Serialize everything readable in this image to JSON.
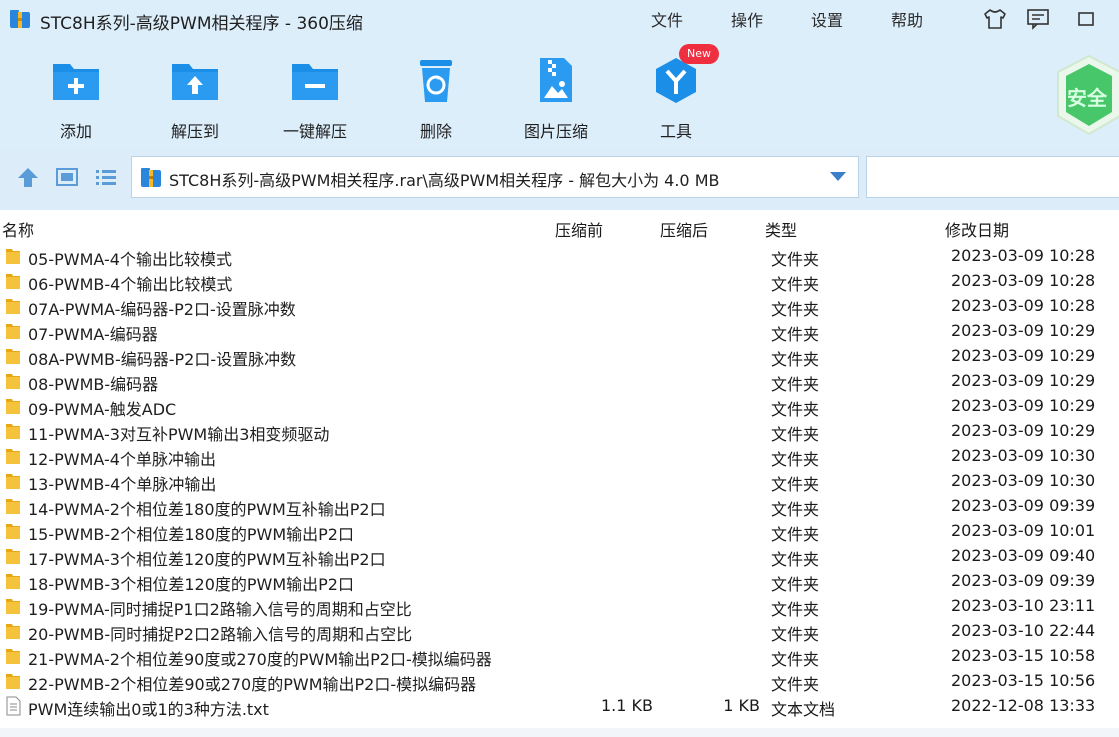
{
  "window": {
    "title": "STC8H系列-高级PWM相关程序 - 360压缩",
    "menu": [
      "文件",
      "操作",
      "设置",
      "帮助"
    ],
    "title_icons": [
      "tshirt-icon",
      "feedback-icon",
      "minimize-icon"
    ]
  },
  "toolbar": {
    "items": [
      {
        "label": "添加",
        "icon": "add-folder-icon"
      },
      {
        "label": "解压到",
        "icon": "extract-to-icon"
      },
      {
        "label": "一键解压",
        "icon": "one-click-extract-icon"
      },
      {
        "label": "删除",
        "icon": "delete-icon"
      },
      {
        "label": "图片压缩",
        "icon": "image-compress-icon"
      },
      {
        "label": "工具",
        "icon": "tools-icon"
      }
    ],
    "new_badge": "New",
    "safe_label": "安全"
  },
  "address": {
    "path": "STC8H系列-高级PWM相关程序.rar\\高级PWM相关程序 - 解包大小为 4.0 MB"
  },
  "columns": {
    "name": "名称",
    "before": "压缩前",
    "after": "压缩后",
    "type": "类型",
    "modified": "修改日期"
  },
  "files": [
    {
      "name": "05-PWMA-4个输出比较模式",
      "before": "",
      "after": "",
      "type": "文件夹",
      "date": "2023-03-09 10:28",
      "kind": "folder"
    },
    {
      "name": "06-PWMB-4个输出比较模式",
      "before": "",
      "after": "",
      "type": "文件夹",
      "date": "2023-03-09 10:28",
      "kind": "folder"
    },
    {
      "name": "07A-PWMA-编码器-P2口-设置脉冲数",
      "before": "",
      "after": "",
      "type": "文件夹",
      "date": "2023-03-09 10:28",
      "kind": "folder"
    },
    {
      "name": "07-PWMA-编码器",
      "before": "",
      "after": "",
      "type": "文件夹",
      "date": "2023-03-09 10:29",
      "kind": "folder"
    },
    {
      "name": "08A-PWMB-编码器-P2口-设置脉冲数",
      "before": "",
      "after": "",
      "type": "文件夹",
      "date": "2023-03-09 10:29",
      "kind": "folder"
    },
    {
      "name": "08-PWMB-编码器",
      "before": "",
      "after": "",
      "type": "文件夹",
      "date": "2023-03-09 10:29",
      "kind": "folder"
    },
    {
      "name": "09-PWMA-触发ADC",
      "before": "",
      "after": "",
      "type": "文件夹",
      "date": "2023-03-09 10:29",
      "kind": "folder"
    },
    {
      "name": "11-PWMA-3对互补PWM输出3相变频驱动",
      "before": "",
      "after": "",
      "type": "文件夹",
      "date": "2023-03-09 10:29",
      "kind": "folder"
    },
    {
      "name": "12-PWMA-4个单脉冲输出",
      "before": "",
      "after": "",
      "type": "文件夹",
      "date": "2023-03-09 10:30",
      "kind": "folder"
    },
    {
      "name": "13-PWMB-4个单脉冲输出",
      "before": "",
      "after": "",
      "type": "文件夹",
      "date": "2023-03-09 10:30",
      "kind": "folder"
    },
    {
      "name": "14-PWMA-2个相位差180度的PWM互补输出P2口",
      "before": "",
      "after": "",
      "type": "文件夹",
      "date": "2023-03-09 09:39",
      "kind": "folder"
    },
    {
      "name": "15-PWMB-2个相位差180度的PWM输出P2口",
      "before": "",
      "after": "",
      "type": "文件夹",
      "date": "2023-03-09 10:01",
      "kind": "folder"
    },
    {
      "name": "17-PWMA-3个相位差120度的PWM互补输出P2口",
      "before": "",
      "after": "",
      "type": "文件夹",
      "date": "2023-03-09 09:40",
      "kind": "folder"
    },
    {
      "name": "18-PWMB-3个相位差120度的PWM输出P2口",
      "before": "",
      "after": "",
      "type": "文件夹",
      "date": "2023-03-09 09:39",
      "kind": "folder"
    },
    {
      "name": "19-PWMA-同时捕捉P1口2路输入信号的周期和占空比",
      "before": "",
      "after": "",
      "type": "文件夹",
      "date": "2023-03-10 23:11",
      "kind": "folder"
    },
    {
      "name": "20-PWMB-同时捕捉P2口2路输入信号的周期和占空比",
      "before": "",
      "after": "",
      "type": "文件夹",
      "date": "2023-03-10 22:44",
      "kind": "folder"
    },
    {
      "name": "21-PWMA-2个相位差90度或270度的PWM输出P2口-模拟编码器",
      "before": "",
      "after": "",
      "type": "文件夹",
      "date": "2023-03-15 10:58",
      "kind": "folder"
    },
    {
      "name": "22-PWMB-2个相位差90或270度的PWM输出P2口-模拟编码器",
      "before": "",
      "after": "",
      "type": "文件夹",
      "date": "2023-03-15 10:56",
      "kind": "folder"
    },
    {
      "name": "PWM连续输出0或1的3种方法.txt",
      "before": "1.1 KB",
      "after": "1 KB",
      "type": "文本文档",
      "date": "2022-12-08 13:33",
      "kind": "file"
    }
  ],
  "colors": {
    "band": "#ddeefb",
    "accent": "#1b8ee8",
    "folder": "#f5c33b",
    "safe": "#3cc46a",
    "badge": "#ef2f40"
  }
}
